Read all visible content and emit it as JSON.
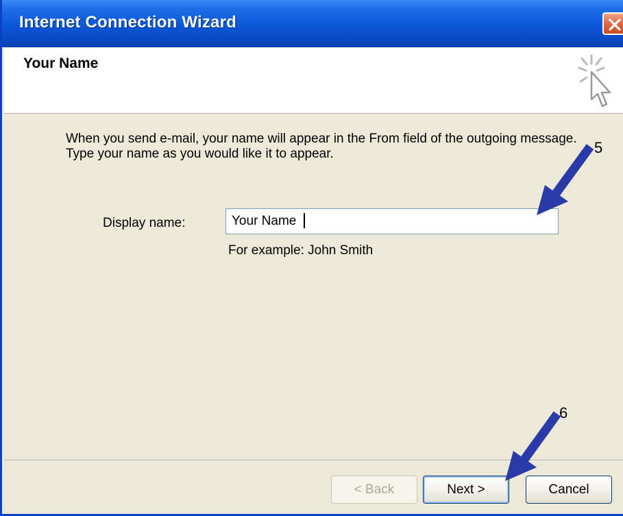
{
  "window": {
    "title": "Internet Connection Wizard"
  },
  "header": {
    "title": "Your Name",
    "icon": "wizard-sparkle-cursor-icon"
  },
  "body": {
    "instruction_line1": "When you send e-mail, your name will appear in the From field of the outgoing message.",
    "instruction_line2": "Type your name as you would like it to appear.",
    "display_name_label": "Display name:",
    "display_name_value": "Your Name",
    "example_text": "For example: John Smith"
  },
  "buttons": {
    "back": "< Back",
    "next": "Next >",
    "cancel": "Cancel"
  },
  "annotations": {
    "step5": "5",
    "step6": "6",
    "arrow_color": "#2a3aa8"
  },
  "colors": {
    "titlebar": "#0a58d8",
    "close_button": "#e06a45",
    "dialog_background": "#ece9d8"
  }
}
